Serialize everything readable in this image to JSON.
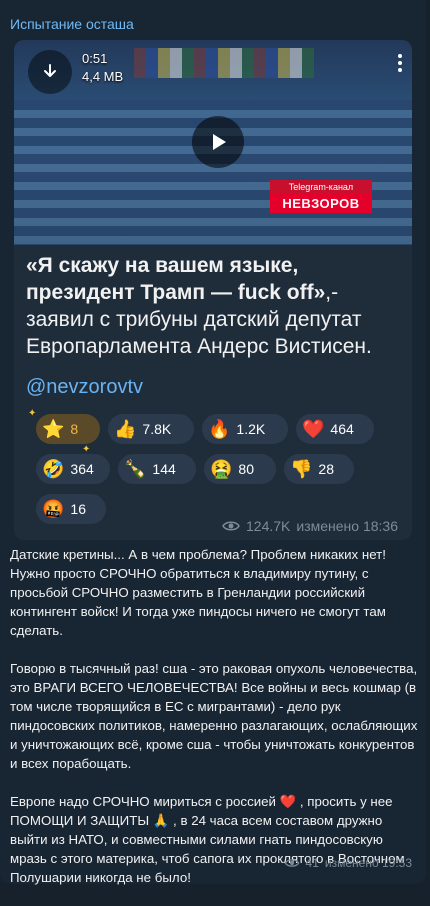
{
  "channel": {
    "name": "Испытание осташа"
  },
  "video": {
    "duration": "0:51",
    "size": "4,4 MB",
    "watermark_top": "Telegram-канал",
    "watermark_bottom": "НЕВЗОРОВ"
  },
  "post": {
    "quote_bold": "«Я скажу на вашем языке, президент Трамп — fuck off»",
    "quote_rest": ",- заявил с трибуны датский депутат Европарламента Андерс Вистисен.",
    "handle": "@nevzorovtv",
    "views": "124.7K",
    "edited": "изменено 18:36"
  },
  "reactions": [
    {
      "emoji": "⭐",
      "count": "8",
      "kind": "star"
    },
    {
      "emoji": "👍",
      "count": "7.8K"
    },
    {
      "emoji": "🔥",
      "count": "1.2K"
    },
    {
      "emoji": "❤️",
      "count": "464"
    },
    {
      "emoji": "🤣",
      "count": "364"
    },
    {
      "emoji": "🍾",
      "count": "144"
    },
    {
      "emoji": "🤮",
      "count": "80"
    },
    {
      "emoji": "👎",
      "count": "28"
    },
    {
      "emoji": "🤬",
      "count": "16"
    }
  ],
  "comment": {
    "p1": "Датские кретины... А в чем проблема? Проблем никаких нет! Нужно просто СРОЧНО обратиться к владимиру путину, с просьбой СРОЧНО разместить в Гренландии российский контингент войск! И тогда уже пиндосы ничего не смогут там сделать.",
    "p2": "Говорю в тысячный раз! сша - это раковая опухоль человечества, это ВРАГИ ВСЕГО ЧЕЛОВЕЧЕСТВА! Все войны и весь кошмар (в том числе творящийся в ЕС с мигрантами) - дело рук пиндосовских политиков, намеренно разлагающих, ослабляющих и уничтожающих всё, кроме сша - чтобы уничтожать конкурентов и всех порабощать.",
    "p3": "Европе надо СРОЧНО мириться с россией ❤️ , просить у нее ПОМОЩИ И ЗАЩИТЫ 🙏 , в 24 часа всем составом дружно выйти из НАТО, и совместными силами гнать пиндосовскую мразь с этого материка, чтоб сапога их проклятого в Восточном Полушарии никогда не было!",
    "views": "41",
    "edited": "изменено 19:53"
  },
  "colors": {
    "accent": "#6ab3f3",
    "bubble": "#182533",
    "star": "#f5b63c"
  }
}
